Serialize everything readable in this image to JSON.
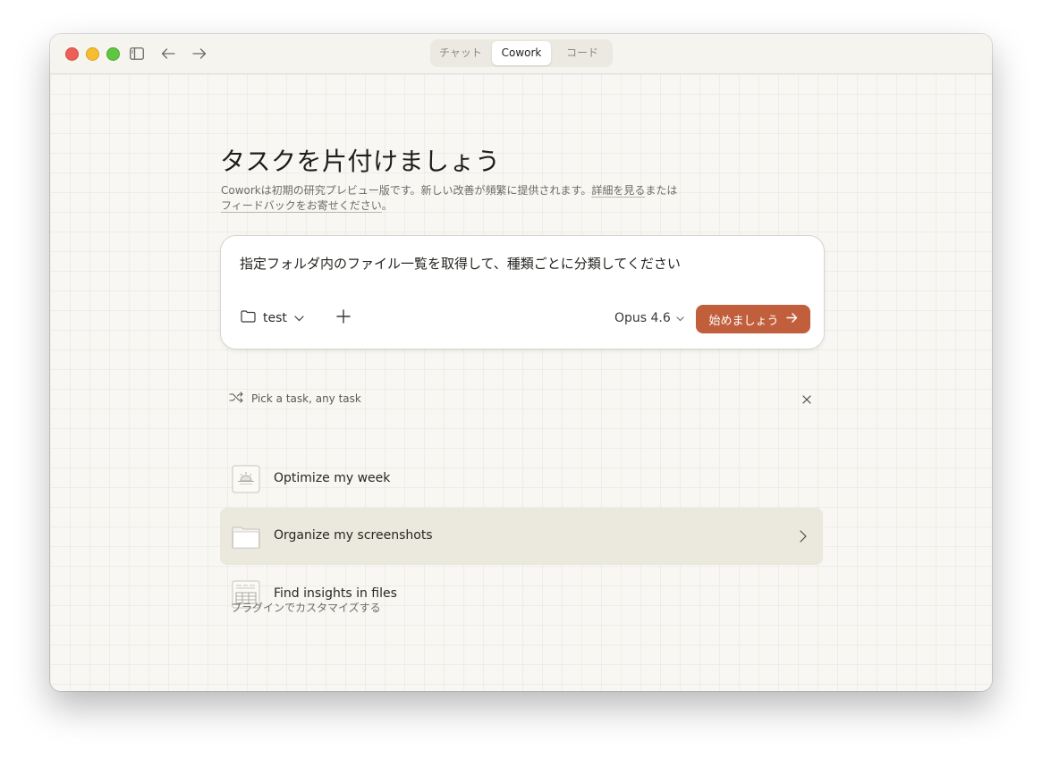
{
  "titlebar": {
    "tabs": [
      {
        "label": "チャット"
      },
      {
        "label": "Cowork"
      },
      {
        "label": "コード"
      }
    ]
  },
  "main": {
    "heading": "タスクを片付けましょう",
    "subtitle_prefix": "Coworkは初期の研究プレビュー版です。新しい改善が頻繁に提供されます。",
    "learn_more": "詳細を見る",
    "or": "または",
    "feedback": "フィードバックをお寄せください",
    "period": "。"
  },
  "composer": {
    "prompt": "指定フォルダ内のファイル一覧を取得して、種類ごとに分類してください",
    "folder": "test",
    "model": "Opus 4.6",
    "submit": "始めましょう"
  },
  "suggestions": {
    "header": "Pick a task, any task",
    "items": [
      {
        "label": "Optimize my week",
        "icon": "sunrise-icon"
      },
      {
        "label": "Organize my screenshots",
        "icon": "folder-icon"
      },
      {
        "label": "Find insights in files",
        "icon": "spreadsheet-icon"
      }
    ],
    "footer": "プラグインでカスタマイズする"
  },
  "colors": {
    "accent": "#c15f3c",
    "active_row": "#ebe9de"
  }
}
